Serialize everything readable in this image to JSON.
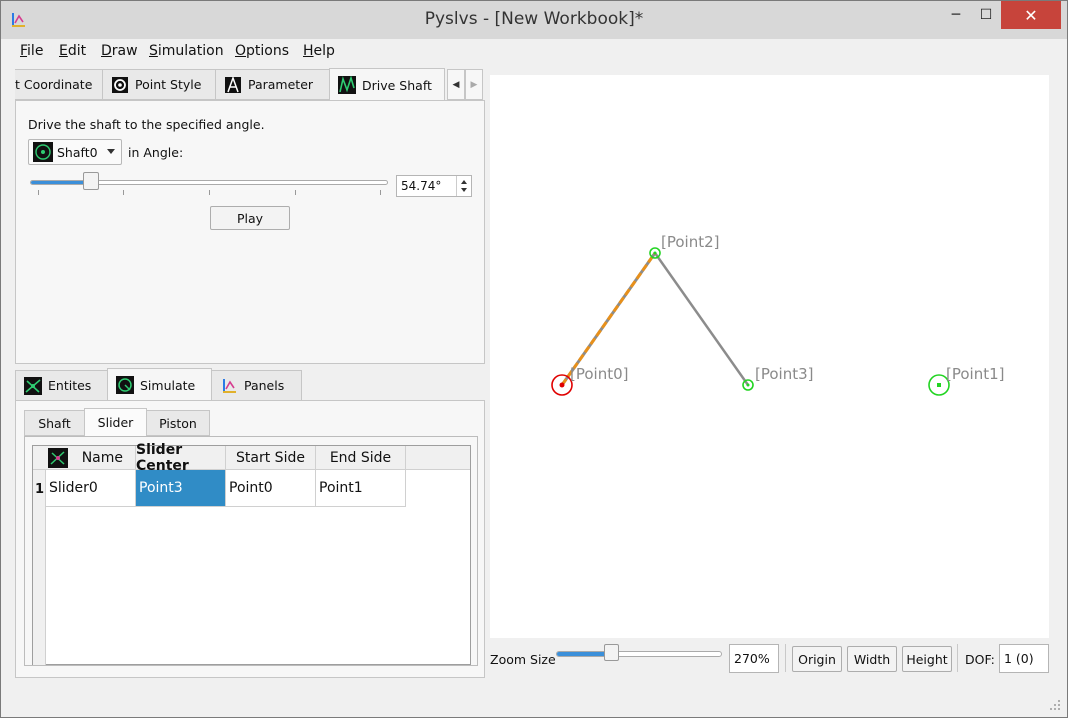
{
  "window": {
    "title": "Pyslvs - [New Workbook]*",
    "min": "─",
    "max": "☐",
    "close": "✕"
  },
  "menu": [
    {
      "label": "File",
      "u": "F",
      "rest": "ile"
    },
    {
      "label": "Edit",
      "u": "E",
      "rest": "dit"
    },
    {
      "label": "Draw",
      "u": "D",
      "rest": "raw"
    },
    {
      "label": "Simulation",
      "u": "S",
      "rest": "imulation"
    },
    {
      "label": "Options",
      "u": "O",
      "rest": "ptions"
    },
    {
      "label": "Help",
      "u": "H",
      "rest": "elp"
    }
  ],
  "top_tabs": {
    "coordinate": "t Coordinate",
    "point_style": "Point Style",
    "parameter": "Parameter",
    "drive_shaft": "Drive Shaft",
    "scroll_left": "◀",
    "scroll_right": "▶"
  },
  "drive_shaft": {
    "description": "Drive the shaft to the specified angle.",
    "shaft_selected": "Shaft0",
    "in_angle_label": "in Angle:",
    "angle_value": "54.74°",
    "slider_fraction": 0.17,
    "play_label": "Play"
  },
  "bottom_tabs": {
    "entities": "Entites",
    "simulate": "Simulate",
    "panels": "Panels"
  },
  "sub_tabs": {
    "shaft": "Shaft",
    "slider": "Slider",
    "piston": "Piston"
  },
  "table": {
    "headers": [
      "Name",
      "Slider Center",
      "Start Side",
      "End Side"
    ],
    "rows": [
      {
        "num": "1",
        "cells": [
          "Slider0",
          "Point3",
          "Point0",
          "Point1"
        ]
      }
    ]
  },
  "canvas": {
    "labels": {
      "p0": "[Point0]",
      "p1": "[Point1]",
      "p2": "[Point2]",
      "p3": "[Point3]"
    },
    "colors": {
      "ground": "#e00000",
      "point": "#22d422",
      "driver": "#e8901a",
      "link": "#8c8c8c",
      "label": "#8a8a8a"
    }
  },
  "status": {
    "zoom_label": "Zoom Size",
    "zoom_value": "270%",
    "zoom_fraction": 0.33,
    "origin": "Origin",
    "width": "Width",
    "height": "Height",
    "dof_label": "DOF:",
    "dof_value": "1 (0)"
  }
}
